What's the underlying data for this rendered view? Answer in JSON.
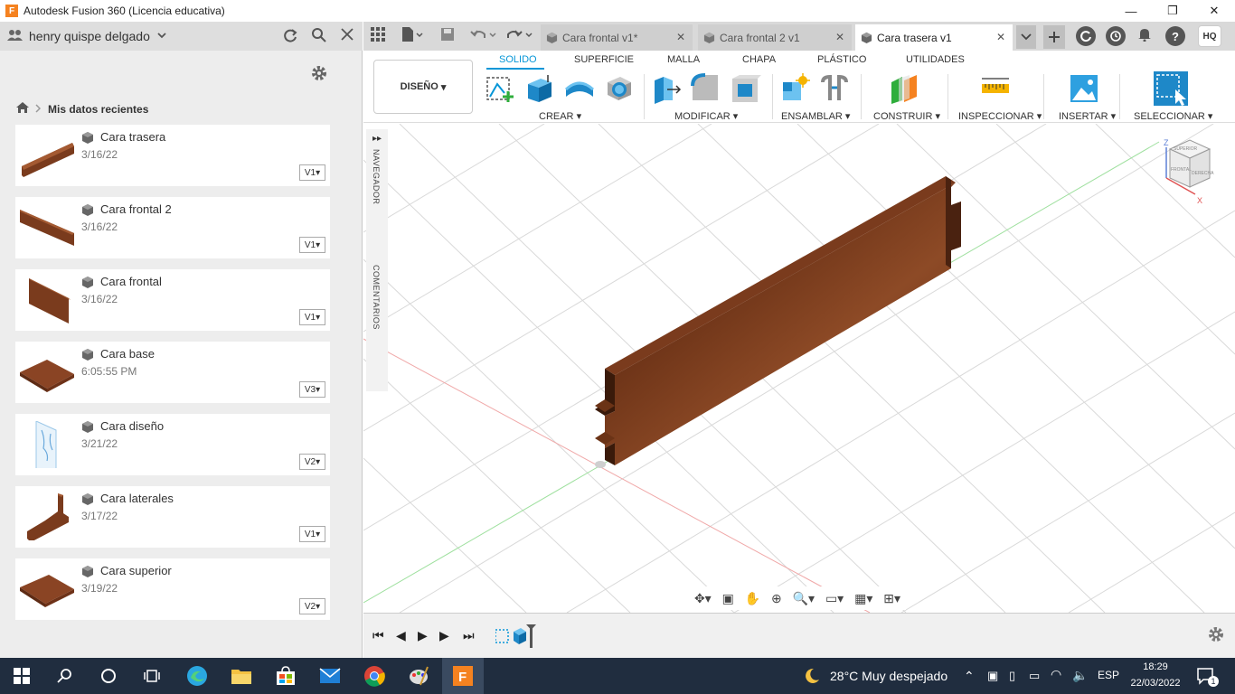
{
  "window": {
    "title": "Autodesk Fusion 360 (Licencia educativa)",
    "logo_letter": "F",
    "minimize": "—",
    "maximize": "❐",
    "close": "✕"
  },
  "data_panel": {
    "user_name": "henry quispe delgado",
    "breadcrumb": "Mis datos recientes",
    "files": [
      {
        "name": "Cara trasera",
        "date": "3/16/22",
        "version": "V1"
      },
      {
        "name": "Cara frontal 2",
        "date": "3/16/22",
        "version": "V1"
      },
      {
        "name": "Cara frontal",
        "date": "3/16/22",
        "version": "V1"
      },
      {
        "name": "Cara base",
        "date": "6:05:55 PM",
        "version": "V3"
      },
      {
        "name": "Cara diseño",
        "date": "3/21/22",
        "version": "V2"
      },
      {
        "name": "Cara laterales",
        "date": "3/17/22",
        "version": "V1"
      },
      {
        "name": "Cara superior",
        "date": "3/19/22",
        "version": "V2"
      }
    ]
  },
  "tabs": [
    {
      "label": "Cara frontal v1*",
      "active": false
    },
    {
      "label": "Cara frontal 2 v1",
      "active": false
    },
    {
      "label": "Cara trasera v1",
      "active": true
    }
  ],
  "user_initials": "HQ",
  "toolbar": {
    "workspace": "DISEÑO",
    "workspace_tabs": [
      "SOLIDO",
      "SUPERFICIE",
      "MALLA",
      "CHAPA",
      "PLÁSTICO",
      "UTILIDADES"
    ],
    "active_tab": "SOLIDO",
    "groups": [
      "CREAR",
      "MODIFICAR",
      "ENSAMBLAR",
      "CONSTRUIR",
      "INSPECCIONAR",
      "INSERTAR",
      "SELECCIONAR"
    ]
  },
  "canvas": {
    "navigator_label": "NAVEGADOR",
    "comments_label": "COMENTARIOS",
    "viewcube_faces": [
      "SUPERIOR",
      "FRONTAL",
      "DERECHA"
    ],
    "axis_z": "Z",
    "axis_x": "X"
  },
  "taskbar": {
    "weather": "28°C  Muy despejado",
    "language": "ESP",
    "time": "18:29",
    "date": "22/03/2022",
    "notifications": "1"
  }
}
